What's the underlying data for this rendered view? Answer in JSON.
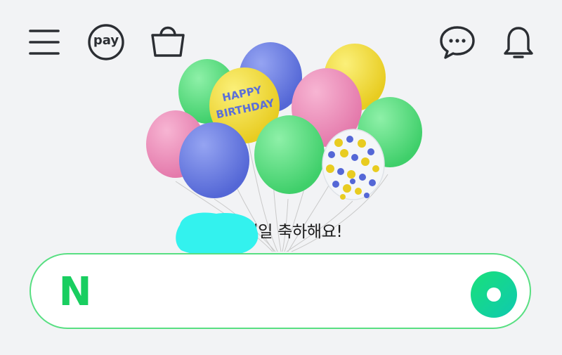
{
  "topbar": {
    "menu_icon": "hamburger-menu-icon",
    "pay_label": "pay",
    "shopping_icon": "shopping-bag-icon",
    "chat_icon": "chat-bubble-icon",
    "notification_icon": "bell-icon"
  },
  "hero": {
    "balloon_text_line1": "HAPPY",
    "balloon_text_line2": "BIRTHDAY",
    "greeting": "님 생일 축하해요!"
  },
  "search": {
    "logo_letter": "N",
    "value": "",
    "placeholder": "",
    "greendot_icon": "greendot-icon"
  },
  "colors": {
    "background": "#f2f3f5",
    "brand_green": "#19ce60",
    "search_border": "#58df82",
    "icon_dark": "#2b2e33",
    "redaction": "#33f2ee",
    "balloon_green": "#5ede83",
    "balloon_blue": "#6b7fe0",
    "balloon_yellow": "#f3de3c",
    "balloon_pink": "#ef93bd"
  }
}
